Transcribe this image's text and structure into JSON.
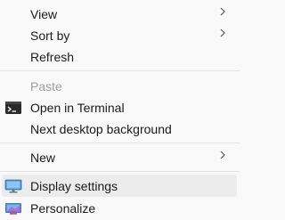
{
  "menu": {
    "view": "View",
    "sort_by": "Sort by",
    "refresh": "Refresh",
    "paste": "Paste",
    "open_terminal": "Open in Terminal",
    "next_background": "Next desktop background",
    "new": "New",
    "display_settings": "Display settings",
    "personalize": "Personalize"
  },
  "icons": {
    "terminal": "terminal-icon",
    "display": "monitor-icon",
    "personalize": "personalize-icon",
    "submenu": "chevron-right-icon"
  },
  "colors": {
    "background": "#f9f9f9",
    "hover": "#ececec",
    "disabled_text": "#9e9e9e"
  }
}
